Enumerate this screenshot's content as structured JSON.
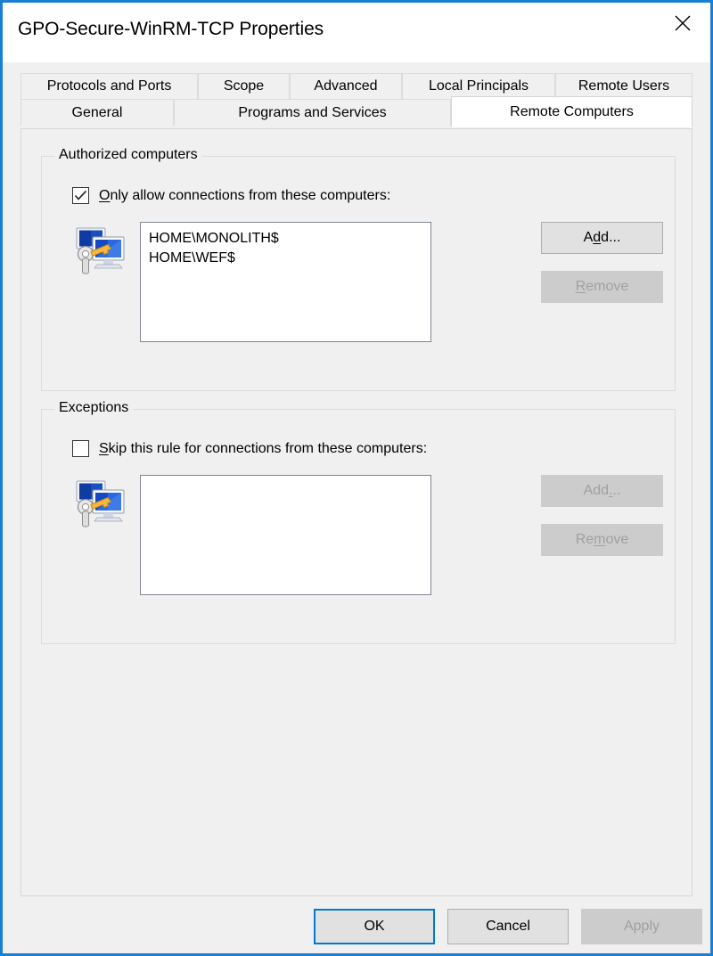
{
  "window": {
    "title": "GPO-Secure-WinRM-TCP Properties",
    "close_icon": "close-icon",
    "border_color": "#1a7fd4"
  },
  "tabs": {
    "row1": [
      {
        "label": "Protocols and Ports",
        "active": false
      },
      {
        "label": "Scope",
        "active": false
      },
      {
        "label": "Advanced",
        "active": false
      },
      {
        "label": "Local Principals",
        "active": false
      },
      {
        "label": "Remote Users",
        "active": false
      }
    ],
    "row2": [
      {
        "label": "General",
        "active": false
      },
      {
        "label": "Programs and Services",
        "active": false
      },
      {
        "label": "Remote Computers",
        "active": true
      }
    ],
    "selected": "Remote Computers"
  },
  "authorized": {
    "group_title": "Authorized computers",
    "checkbox": {
      "checked": true,
      "label_before": "O",
      "label_mnemonic": "O",
      "label": "Only allow connections from these computers:",
      "label_pre": "",
      "label_post": "nly allow connections from these computers:"
    },
    "icon": "computers-key-icon",
    "list": [
      "HOME\\MONOLITH$",
      "HOME\\WEF$"
    ],
    "add_button": {
      "pre": "A",
      "mnemonic": "d",
      "post": "d...",
      "label": "Add...",
      "enabled": true
    },
    "remove_button": {
      "pre": "",
      "mnemonic": "R",
      "post": "emove",
      "label": "Remove",
      "enabled": false
    }
  },
  "exceptions": {
    "group_title": "Exceptions",
    "checkbox": {
      "checked": false,
      "label": "Skip this rule for connections from these computers:",
      "label_pre": "",
      "label_mnemonic": "S",
      "label_post": "kip this rule for connections from these computers:"
    },
    "icon": "computers-key-icon",
    "list": [],
    "add_button": {
      "pre": "Add",
      "mnemonic": ".",
      "post": "..",
      "label": "Add...",
      "enabled": false
    },
    "remove_button": {
      "pre": "Re",
      "mnemonic": "m",
      "post": "ove",
      "label": "Remove",
      "enabled": false
    }
  },
  "footer": {
    "ok": "OK",
    "cancel": "Cancel",
    "apply": "Apply",
    "apply_enabled": false,
    "default_button": "OK"
  },
  "colors": {
    "accent": "#0078d7",
    "window_border": "#1a7fd4",
    "dialog_bg": "#f0f0f0",
    "field_bg": "#ffffff",
    "disabled_text": "#a0a0a0"
  }
}
